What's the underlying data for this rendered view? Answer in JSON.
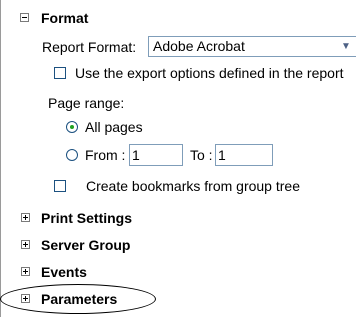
{
  "format": {
    "title": "Format",
    "report_format_label": "Report Format:",
    "report_format_value": "Adobe Acrobat",
    "export_options_label": "Use the export options defined in the report",
    "export_options_checked": false,
    "page_range_label": "Page range:",
    "all_pages_label": "All pages",
    "all_pages_selected": true,
    "from_label": "From :",
    "from_value": "1",
    "to_label": "To :",
    "to_value": "1",
    "bookmarks_label": "Create bookmarks from group tree",
    "bookmarks_checked": false
  },
  "sections": {
    "print_settings": "Print Settings",
    "server_group": "Server Group",
    "events": "Events",
    "parameters": "Parameters"
  }
}
